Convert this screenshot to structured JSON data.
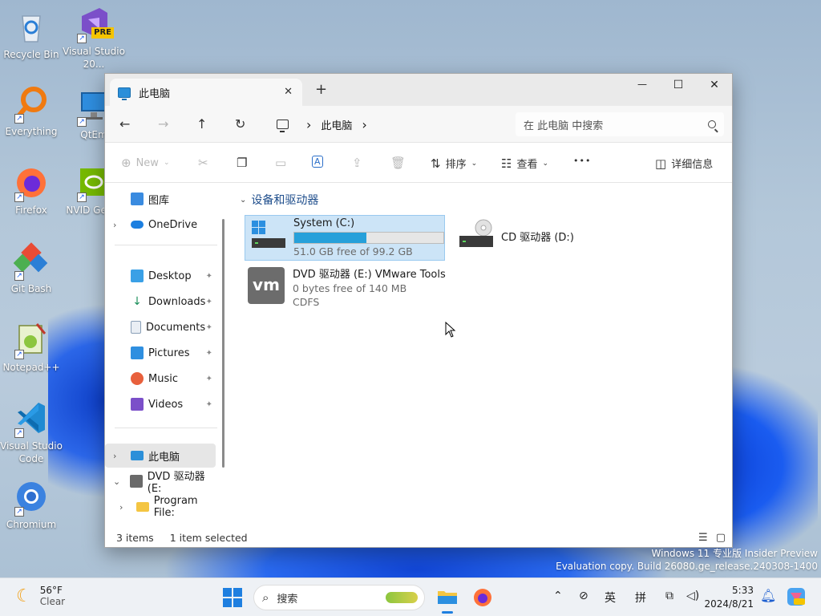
{
  "desktop": {
    "icons": [
      {
        "label": "Recycle Bin"
      },
      {
        "label": "Visual Studio 20..."
      },
      {
        "label": "Everything"
      },
      {
        "label": "QtEm"
      },
      {
        "label": "Firefox"
      },
      {
        "label": "NVID GeFor"
      },
      {
        "label": "Git Bash"
      },
      {
        "label": "Notepad++"
      },
      {
        "label": "Visual Studio Code"
      },
      {
        "label": "Chromium"
      }
    ],
    "pre_badge": "PRE"
  },
  "window": {
    "tab_title": "此电脑",
    "tab_close": "✕",
    "new_tab": "+",
    "minimize": "—",
    "maximize": "☐",
    "close": "✕",
    "breadcrumb": {
      "sep1": "›",
      "location": "此电脑",
      "sep2": "›"
    },
    "search_placeholder": "在 此电脑 中搜索",
    "commands": {
      "new": "New",
      "sort": "排序",
      "view": "查看",
      "more": "•••",
      "details": "详细信息"
    },
    "nav": {
      "gallery": "图库",
      "onedrive": "OneDrive",
      "desktop": "Desktop",
      "downloads": "Downloads",
      "documents": "Documents",
      "pictures": "Pictures",
      "music": "Music",
      "videos": "Videos",
      "thispc": "此电脑",
      "dvd": "DVD 驱动器 (E:",
      "programfiles": "Program File:"
    },
    "group_header": "设备和驱动器",
    "drives": [
      {
        "name": "System (C:)",
        "detail": "51.0 GB free of 99.2 GB",
        "used_fraction": 0.486
      },
      {
        "name": "CD 驱动器 (D:)"
      },
      {
        "name": "DVD 驱动器 (E:) VMware Tools",
        "detail": "0 bytes free of 140 MB",
        "fs": "CDFS"
      }
    ],
    "vm_logo_text": "vm",
    "status": {
      "items": "3 items",
      "selected": "1 item selected"
    }
  },
  "watermark": {
    "line1": "Windows 11 专业版 Insider Preview",
    "line2": "Evaluation copy. Build 26080.ge_release.240308-1400"
  },
  "taskbar": {
    "weather_temp": "56°F",
    "weather_desc": "Clear",
    "search_label": "搜索",
    "ime_lang": "英",
    "ime_mode": "拼",
    "time": "5:33",
    "date": "2024/8/21"
  },
  "colors": {
    "accent": "#26a0da",
    "selection": "#cce4f7",
    "group_header": "#1f4e8c"
  }
}
